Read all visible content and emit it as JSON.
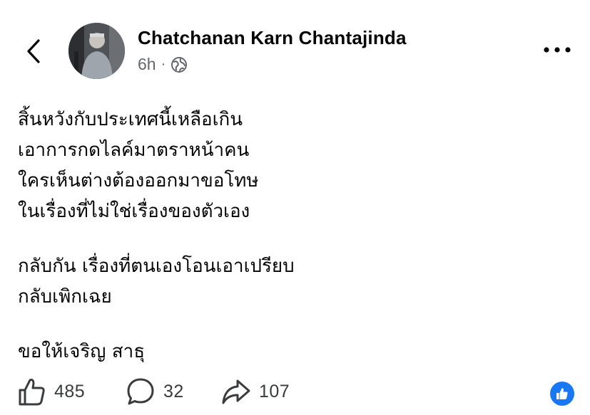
{
  "header": {
    "back_icon": "chevron-left-icon",
    "author_name": "Chatchanan Karn Chantajinda",
    "timestamp": "6h",
    "separator": "·",
    "audience_icon": "globe-icon",
    "more_icon": "more-horizontal-icon"
  },
  "post": {
    "paragraphs": [
      [
        "สิ้นหวังกับประเทศนี้เหลือเกิน",
        "เอาการกดไลค์มาตราหน้าคน",
        "ใครเห็นต่างต้องออกมาขอโทษ",
        "ในเรื่องที่ไม่ใช่เรื่องของตัวเอง"
      ],
      [
        "กลับกัน เรื่องที่ตนเองโอนเอาเปรียบ",
        "กลับเพิกเฉย"
      ],
      [
        "ขอให้เจริญ สาธุ"
      ]
    ]
  },
  "footer": {
    "likes": "485",
    "comments": "32",
    "shares": "107",
    "like_icon": "thumbs-up-icon",
    "comment_icon": "comment-icon",
    "share_icon": "share-arrow-icon",
    "reaction_badge_icon": "like-reaction-badge-icon"
  },
  "colors": {
    "text": "#050505",
    "secondary_text": "#65676b",
    "brand_blue": "#1877f2"
  }
}
